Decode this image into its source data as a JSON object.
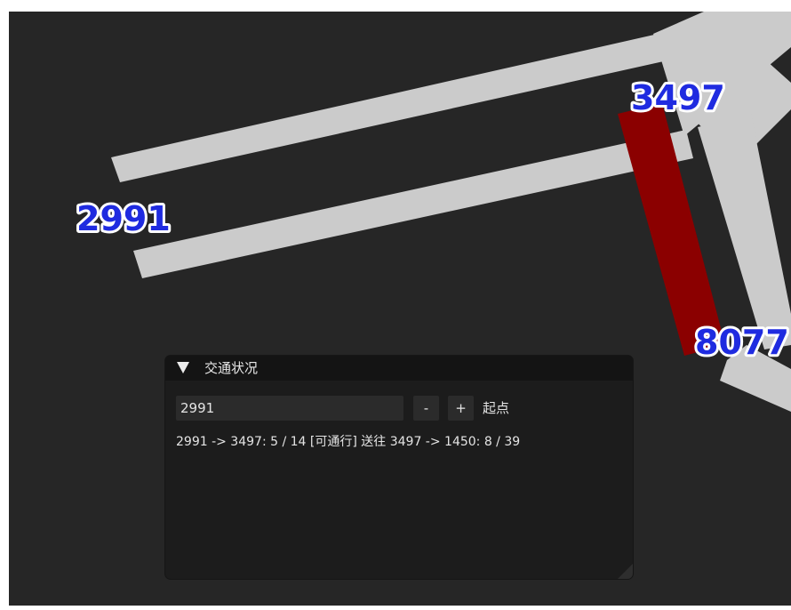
{
  "scene": {
    "background_color": "#262626",
    "road_color": "#cbcbcb",
    "congested_color": "#8b0000",
    "label_color": "#1f2be0",
    "node_labels": {
      "n2991": "2991",
      "n3497": "3497",
      "n8077": "8077"
    }
  },
  "panel": {
    "title": "交通状况",
    "collapse_icon": "triangle-down-icon",
    "node_input_value": "2991",
    "minus_label": "-",
    "plus_label": "+",
    "start_label": "起点",
    "status_line": "2991 -> 3497: 5 / 14 [可通行] 送往 3497 -> 1450: 8 / 39"
  }
}
